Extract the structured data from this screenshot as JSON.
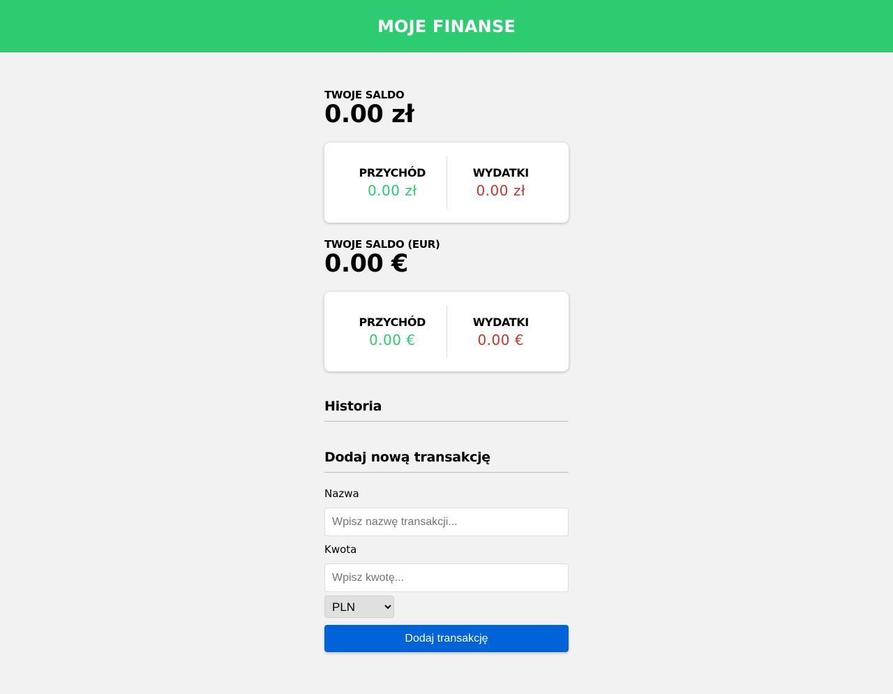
{
  "header": {
    "title": "MOJE FINANSE"
  },
  "pln": {
    "balance_label": "TWOJE SALDO",
    "balance_value": "0.00 zł",
    "income_label": "PRZYCHÓD",
    "income_value": "0.00 zł",
    "expense_label": "WYDATKI",
    "expense_value": "0.00 zł"
  },
  "eur": {
    "balance_label": "TWOJE SALDO (EUR)",
    "balance_value": "0.00 €",
    "income_label": "PRZYCHÓD",
    "income_value": "0.00 €",
    "expense_label": "WYDATKI",
    "expense_value": "0.00 €"
  },
  "history": {
    "title": "Historia"
  },
  "form": {
    "title": "Dodaj nową transakcję",
    "name_label": "Nazwa",
    "name_placeholder": "Wpisz nazwę transakcji...",
    "amount_label": "Kwota",
    "amount_placeholder": "Wpisz kwotę...",
    "currency_selected": "PLN",
    "submit_label": "Dodaj transakcję"
  },
  "colors": {
    "header": "#2ecc71",
    "income": "#2ecc71",
    "expense": "#c0392b",
    "button": "#0064d8",
    "background": "#f2f2f2"
  }
}
